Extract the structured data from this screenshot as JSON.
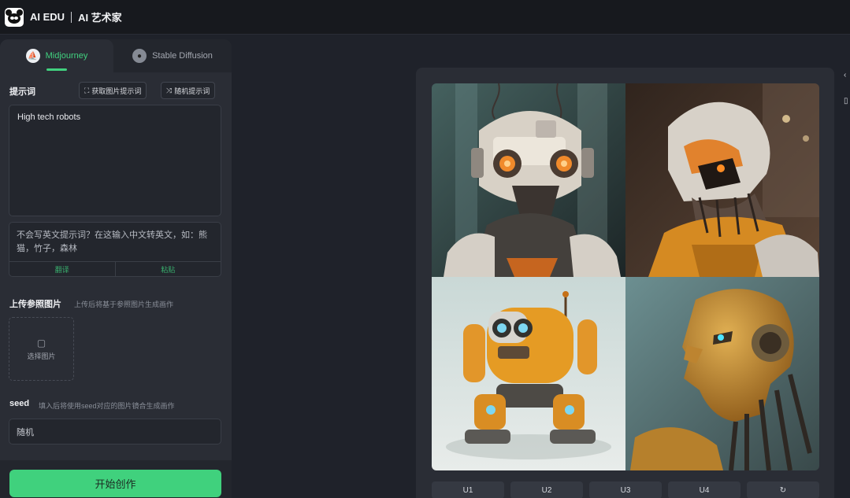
{
  "header": {
    "brand": "AI EDU",
    "subtitle": "AI 艺术家"
  },
  "tabs": [
    {
      "label": "Midjourney",
      "active": true
    },
    {
      "label": "Stable Diffusion",
      "active": false
    }
  ],
  "prompt": {
    "label": "提示词",
    "buttons": [
      "获取图片提示词",
      "随机提示词"
    ],
    "value": "High tech robots"
  },
  "translate": {
    "placeholder": "不会写英文提示词？在这输入中文转英文，如：熊猫，竹子，森林",
    "actions": [
      "翻译",
      "粘贴"
    ]
  },
  "upload": {
    "label": "上传参照图片",
    "hint": "上传后将基于参照图片生成画作",
    "button_label": "选择图片"
  },
  "seed": {
    "label": "seed",
    "hint": "填入后将使用seed对应的图片镜合生成画作",
    "value": "随机"
  },
  "actions": {
    "start": "开始创作"
  },
  "results": {
    "upscale_buttons": [
      "U1",
      "U2",
      "U3",
      "U4"
    ],
    "extra_icon": "refresh-icon",
    "images": [
      "white robot head with orange eyes",
      "robot head with orange chest plating",
      "orange walking robot",
      "golden humanoid robot profile"
    ]
  },
  "colors": {
    "accent": "#41d17f",
    "panel": "#2a2d35",
    "background": "#1f222a"
  }
}
